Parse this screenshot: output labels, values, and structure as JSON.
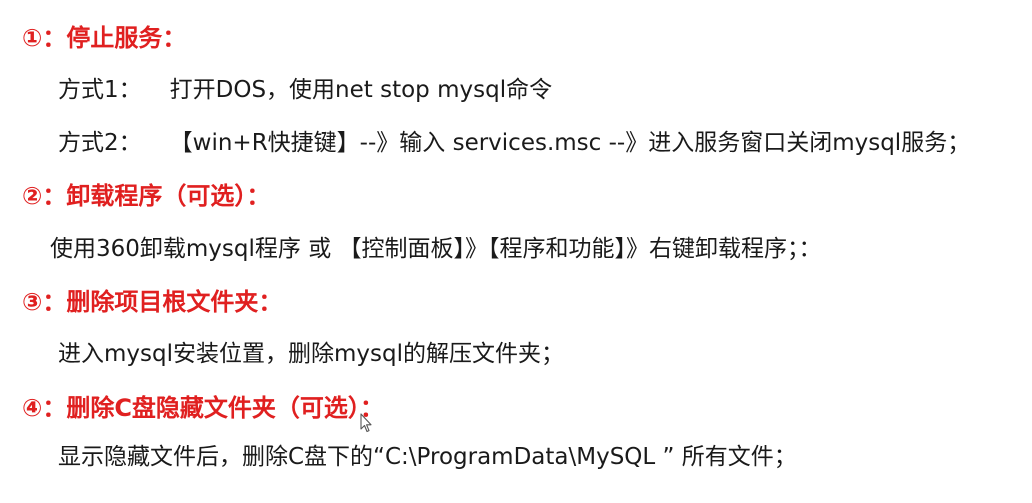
{
  "sections": [
    {
      "heading": "①：停止服务：",
      "lines": [
        {
          "label": "方式1：",
          "text": "打开DOS，使用net stop mysql命令"
        },
        {
          "label": "方式2：",
          "text": "【win+R快捷键】--》输入 services.msc --》进入服务窗口关闭mysql服务；"
        }
      ]
    },
    {
      "heading": "②：卸载程序（可选）：",
      "lines": [
        {
          "text": "使用360卸载mysql程序 或 【控制面板】》【程序和功能】》右键卸载程序；："
        }
      ]
    },
    {
      "heading": "③：删除项目根文件夹：",
      "lines": [
        {
          "text": "进入mysql安装位置，删除mysql的解压文件夹；"
        }
      ]
    },
    {
      "heading": "④：删除C盘隐藏文件夹（可选）：",
      "lines": [
        {
          "text": "显示隐藏文件后，删除C盘下的“C:\\ProgramData\\MySQL ” 所有文件；"
        }
      ]
    }
  ],
  "colors": {
    "heading": "#e02020",
    "body": "#1a1a1a"
  },
  "cursor_icon": "mouse-pointer-icon"
}
